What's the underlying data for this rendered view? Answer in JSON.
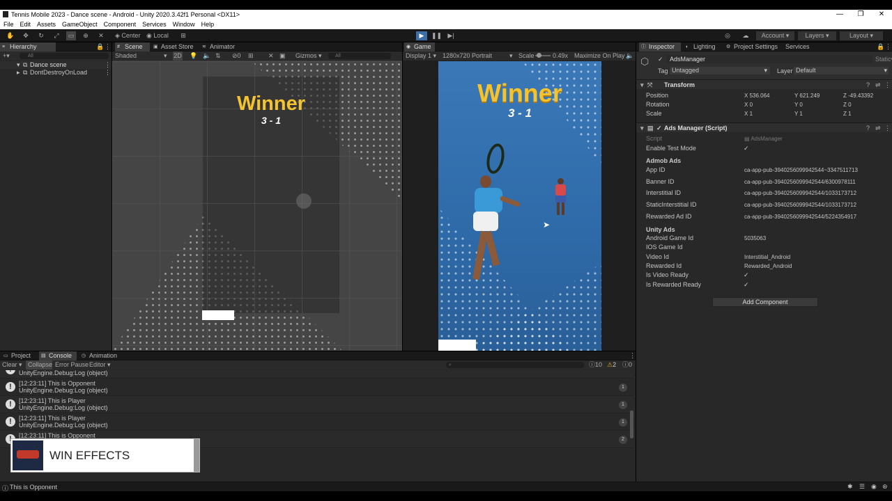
{
  "window": {
    "title": "Tennis Mobile 2023 - Dance scene - Android - Unity 2020.3.42f1 Personal <DX11>",
    "controls": [
      "—",
      "❐",
      "✕"
    ]
  },
  "menu": [
    "File",
    "Edit",
    "Assets",
    "GameObject",
    "Component",
    "Services",
    "Window",
    "Help"
  ],
  "toolbar": {
    "pivot": "Center",
    "space": "Local",
    "account": "Account",
    "layers": "Layers",
    "layout": "Layout"
  },
  "hierarchy": {
    "tab": "Hierarchy",
    "search_placeholder": "All",
    "items": [
      "Dance scene",
      "DontDestroyOnLoad"
    ]
  },
  "scene_view": {
    "tabs": [
      "Scene",
      "Asset Store",
      "Animator"
    ],
    "shading": "Shaded",
    "mode_2d": "2D",
    "gizmos": "Gizmos",
    "search": "All",
    "winner_text": "Winner",
    "score_text": "3 - 1"
  },
  "game_view": {
    "tab": "Game",
    "display": "Display 1",
    "resolution": "1280x720 Portrait",
    "scale_label": "Scale",
    "scale_value": "0.49x",
    "maximize": "Maximize On Play",
    "winner_text": "Winner",
    "score_text": "3 - 1"
  },
  "inspector": {
    "tabs": [
      "Inspector",
      "Lighting",
      "Project Settings",
      "Services"
    ],
    "object_name": "AdsManager",
    "static_label": "Static",
    "tag_label": "Tag",
    "tag_value": "Untagged",
    "layer_label": "Layer",
    "layer_value": "Default",
    "transform": {
      "title": "Transform",
      "position_label": "Position",
      "rotation_label": "Rotation",
      "scale_label": "Scale",
      "position": [
        "536.064",
        "621.249",
        "-49.43392"
      ],
      "rotation": [
        "0",
        "0",
        "0"
      ],
      "scale": [
        "1",
        "1",
        "1"
      ]
    },
    "script": {
      "title": "Ads Manager (Script)",
      "script_label": "Script",
      "script_value": "AdsManager",
      "enable_test_mode": "Enable Test Mode",
      "admob_header": "Admob Ads",
      "app_id_label": "App ID",
      "app_id": "ca-app-pub-3940256099942544~3347511713",
      "banner_id_label": "Banner ID",
      "banner_id": "ca-app-pub-3940256099942544/6300978111",
      "interstitial_id_label": "Interstitial ID",
      "interstitial_id": "ca-app-pub-3940256099942544/1033173712",
      "static_interstitial_label": "StaticInterstitial ID",
      "static_interstitial_id": "ca-app-pub-3940256099942544/1033173712",
      "rewarded_ad_label": "Rewarded Ad ID",
      "rewarded_ad_id": "ca-app-pub-3940256099942544/5224354917",
      "unity_header": "Unity Ads",
      "android_game_id_label": "Android Game Id",
      "android_game_id": "5035063",
      "ios_game_id_label": "IOS Game Id",
      "ios_game_id": "",
      "video_id_label": "Video Id",
      "video_id": "Interstitial_Android",
      "rewarded_id_label": "Rewarded Id",
      "rewarded_id": "Rewarded_Android",
      "is_video_ready": "Is Video Ready",
      "is_rewarded_ready": "Is Rewarded Ready"
    },
    "add_component": "Add Component"
  },
  "bottom": {
    "tabs": [
      "Project",
      "Console",
      "Animation"
    ],
    "clear": "Clear",
    "collapse": "Collapse",
    "error_pause": "Error Pause",
    "editor": "Editor",
    "counts": {
      "info": "10",
      "warn": "2",
      "error": "0"
    },
    "logs": [
      {
        "l1": "",
        "l2": "UnityEngine.Debug:Log (object)",
        "count": ""
      },
      {
        "l1": "[12:23:11] This is Opponent",
        "l2": "UnityEngine.Debug:Log (object)",
        "count": "1"
      },
      {
        "l1": "[12:23:11] This is Player",
        "l2": "UnityEngine.Debug:Log (object)",
        "count": "1"
      },
      {
        "l1": "[12:23:11] This is Player",
        "l2": "UnityEngine.Debug:Log (object)",
        "count": "1"
      },
      {
        "l1": "[12:23:11] This is Opponent",
        "l2": "",
        "count": "2"
      }
    ]
  },
  "overlay": {
    "caption": "WIN EFFECTS"
  },
  "status": {
    "text": "This is Opponent"
  }
}
